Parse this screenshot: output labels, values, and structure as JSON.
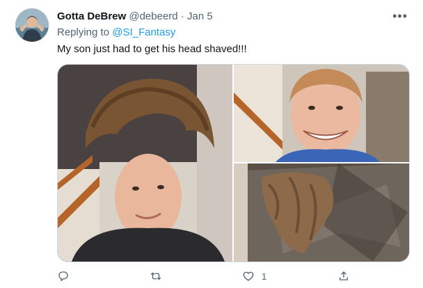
{
  "tweet": {
    "display_name": "Gotta DeBrew",
    "handle": "@debeerd",
    "separator": "·",
    "date": "Jan 5",
    "more_label": "•••",
    "replying_prefix": "Replying to",
    "replying_to": "@SI_Fantasy",
    "text": "My son just had to get his head shaved!!!",
    "like_count": "1"
  },
  "icons": {
    "reply": "reply-icon",
    "retweet": "retweet-icon",
    "like": "heart-icon",
    "share": "share-icon"
  },
  "colors": {
    "link": "#1d9bf0",
    "muted": "#536471",
    "text": "#0f1419"
  }
}
